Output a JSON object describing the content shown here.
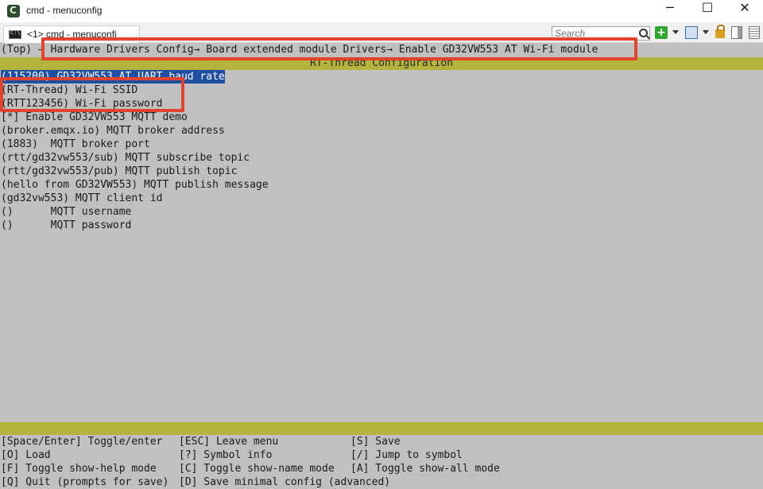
{
  "window": {
    "title": "cmd - menuconfig",
    "minimize": "─",
    "maximize": "☐",
    "close": "✕"
  },
  "tabbar": {
    "tab_label": "<1> cmd - menuconfi",
    "search_placeholder": "Search",
    "add_label": "+"
  },
  "terminal": {
    "breadcrumb": "(Top) → Hardware Drivers Config→ Board extended module Drivers→ Enable GD32VW553 AT Wi-Fi module",
    "heading": "RT-Thread Configuration",
    "items": [
      "(115200) GD32VW553 AT UART baud rate",
      "(RT-Thread) Wi-Fi SSID",
      "(RTT123456) Wi-Fi password",
      "[*] Enable GD32VW553 MQTT demo",
      "(broker.emqx.io) MQTT broker address",
      "(1883)  MQTT broker port",
      "(rtt/gd32vw553/sub) MQTT subscribe topic",
      "(rtt/gd32vw553/pub) MQTT publish topic",
      "(hello from GD32VW553) MQTT publish message",
      "(gd32vw553) MQTT client id",
      "()      MQTT username",
      "()      MQTT password"
    ],
    "help": [
      [
        "[Space/Enter] Toggle/enter",
        "[ESC] Leave menu",
        "[S] Save"
      ],
      [
        "[O] Load",
        "[?] Symbol info",
        "[/] Jump to symbol"
      ],
      [
        "[F] Toggle show-help mode",
        "[C] Toggle show-name mode",
        "[A] Toggle show-all mode"
      ],
      [
        "[Q] Quit (prompts for save)",
        "[D] Save minimal config (advanced)",
        ""
      ]
    ]
  },
  "colors": {
    "terminal_bg": "#c0c0c0",
    "yellow_bar": "#b4b43c",
    "selection": "#1f4fa3",
    "annotation": "#e0442c"
  }
}
